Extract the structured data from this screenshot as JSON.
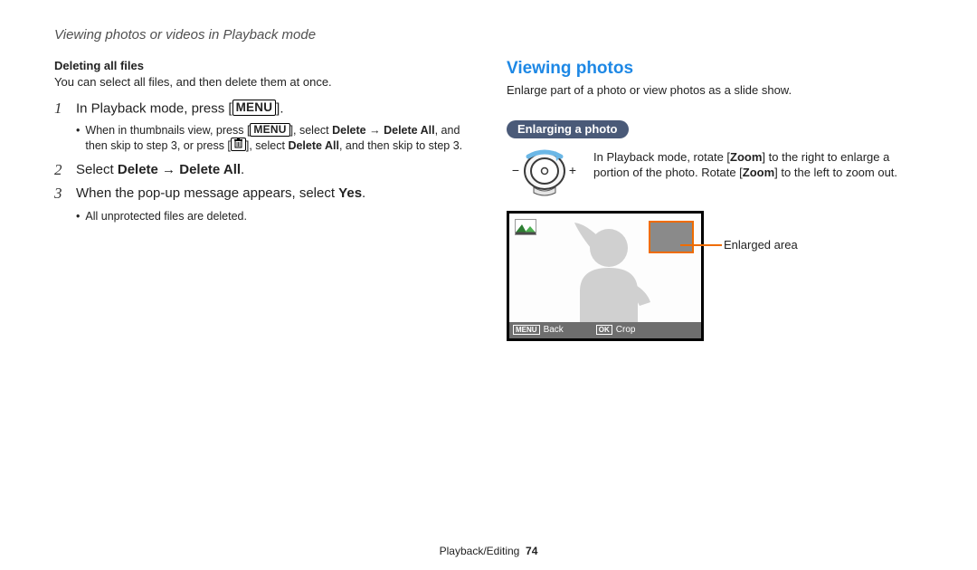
{
  "chapter_title": "Viewing photos or videos in Playback mode",
  "left": {
    "subhead": "Deleting all files",
    "intro": "You can select all files, and then delete them at once.",
    "steps": [
      {
        "num": "1",
        "lead": "In Playback mode, press [",
        "menu_big": "MENU",
        "tail": "].",
        "bullet_pre": "When in thumbnails view, press [",
        "bullet_menu": "MENU",
        "bullet_mid1": "], select ",
        "bullet_bold1": "Delete",
        "bullet_arrow": " → ",
        "bullet_bold2": "Delete All",
        "bullet_mid2": ", and then skip to step 3, or press [",
        "bullet_mid3": "], select ",
        "bullet_bold3": "Delete All",
        "bullet_end": ", and then skip to step 3."
      },
      {
        "num": "2",
        "lead": "Select ",
        "bold1": "Delete",
        "arrow": " → ",
        "bold2": "Delete All",
        "tail": "."
      },
      {
        "num": "3",
        "lead": "When the pop-up message appears, select ",
        "bold1": "Yes",
        "tail": ".",
        "bullet": "All unprotected files are deleted."
      }
    ]
  },
  "right": {
    "title": "Viewing photos",
    "intro": "Enlarge part of a photo or view photos as a slide show.",
    "pill": "Enlarging a photo",
    "zoom_text_pre": "In Playback mode, rotate [",
    "zoom_bold1": "Zoom",
    "zoom_text_mid": "] to the right to enlarge a portion of the photo. Rotate [",
    "zoom_bold2": "Zoom",
    "zoom_text_end": "] to the left to zoom out.",
    "enlarged_label": "Enlarged area",
    "status": {
      "menu": "MENU",
      "back": "Back",
      "ok": "OK",
      "crop": "Crop"
    }
  },
  "footer": {
    "section": "Playback/Editing",
    "page": "74"
  }
}
